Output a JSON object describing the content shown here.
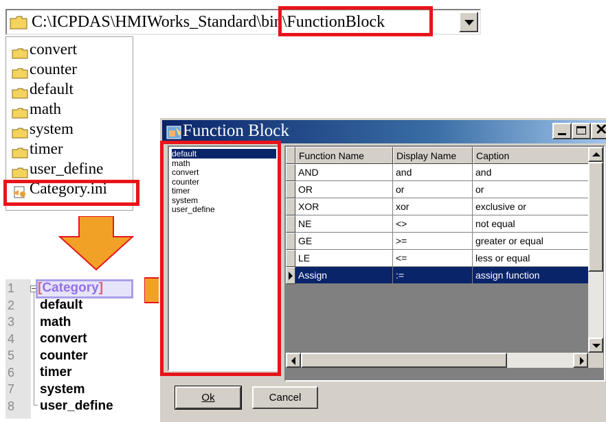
{
  "path_combo": {
    "path": "C:\\ICPDAS\\HMIWorks_Standard\\bin\\FunctionBlock"
  },
  "folders": [
    "convert",
    "counter",
    "default",
    "math",
    "system",
    "timer",
    "user_define"
  ],
  "ini_file": "Category.ini",
  "ini_editor": {
    "line_numbers": [
      "1",
      "2",
      "3",
      "4",
      "5",
      "6",
      "7",
      "8"
    ],
    "section_open": "[",
    "section_name": "Category",
    "section_close": "]",
    "entries": [
      "default",
      "math",
      "convert",
      "counter",
      "timer",
      "system",
      "user_define"
    ]
  },
  "dialog": {
    "title": "Function Block",
    "categories": [
      "default",
      "math",
      "convert",
      "counter",
      "timer",
      "system",
      "user_define"
    ],
    "selected_category": "default",
    "columns": [
      "Function Name",
      "Display Name",
      "Caption"
    ],
    "rows": [
      [
        "AND",
        "and",
        "and"
      ],
      [
        "OR",
        "or",
        "or"
      ],
      [
        "XOR",
        "xor",
        "exclusive or"
      ],
      [
        "NE",
        "<>",
        "not equal"
      ],
      [
        "GE",
        ">=",
        "greater or equal"
      ],
      [
        "LE",
        "<=",
        "less or equal"
      ],
      [
        "Assign",
        ":=",
        "assign function"
      ]
    ],
    "ok_label": "Ok",
    "cancel_label": "Cancel"
  },
  "colors": {
    "highlight": "#e8141a",
    "arrow": "#f2a127",
    "selection": "#0a246a",
    "section": "#6a2ce0"
  }
}
